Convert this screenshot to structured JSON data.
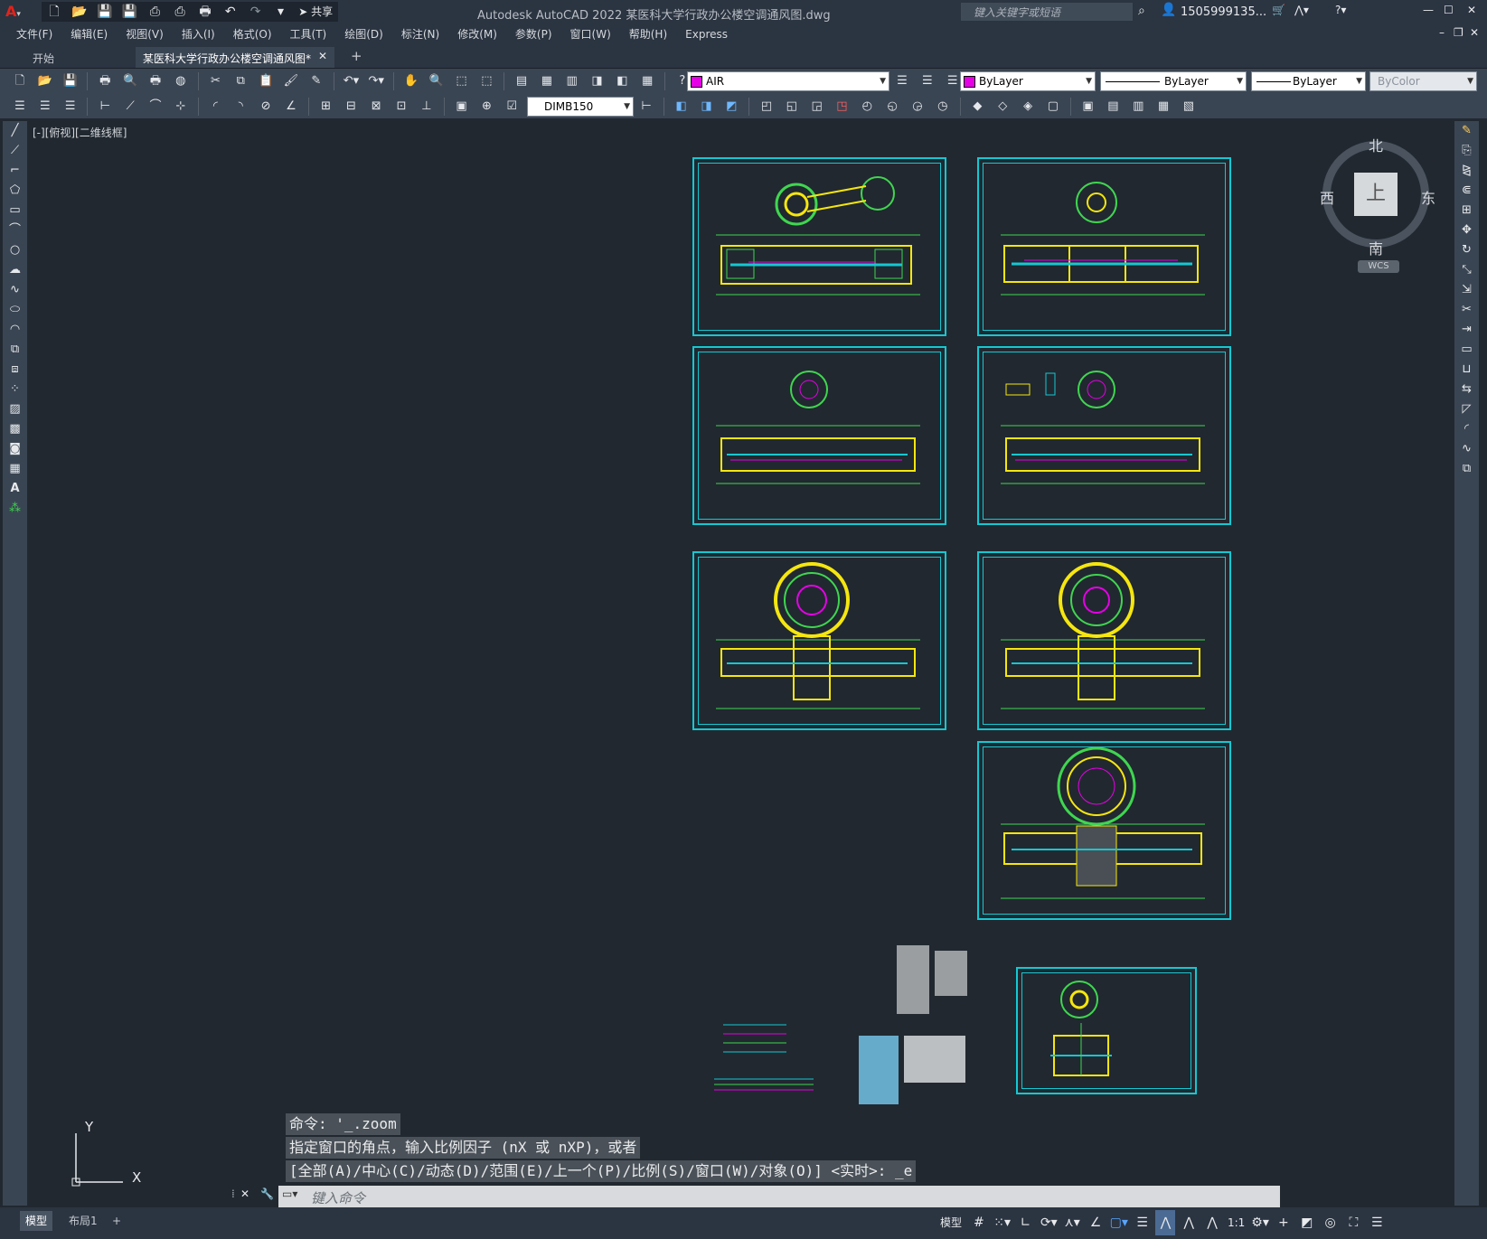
{
  "window": {
    "title": "Autodesk AutoCAD 2022    某医科大学行政办公楼空调通风图.dwg",
    "share_label": "共享",
    "search_placeholder": "键入关键字或短语",
    "user": "1505999135...",
    "minimize": "—",
    "maximize": "☐",
    "close": "✕"
  },
  "menu": [
    "文件(F)",
    "编辑(E)",
    "视图(V)",
    "插入(I)",
    "格式(O)",
    "工具(T)",
    "绘图(D)",
    "标注(N)",
    "修改(M)",
    "参数(P)",
    "窗口(W)",
    "帮助(H)",
    "Express"
  ],
  "tabs": {
    "start": "开始",
    "drawing": "某医科大学行政办公楼空调通风图*",
    "add": "+"
  },
  "toolbar": {
    "layer": "AIR",
    "color": "ByLayer",
    "linetype": "ByLayer",
    "lineweight": "ByLayer",
    "plotstyle": "ByColor",
    "dimstyle": "DIMB150"
  },
  "viewport_label": "[-][俯视][二维线框]",
  "viewcube": {
    "north": "北",
    "south": "南",
    "east": "东",
    "west": "西",
    "top": "上",
    "wcs": "WCS"
  },
  "ucs": {
    "x": "X",
    "y": "Y"
  },
  "command": {
    "history": [
      "命令: '_.zoom",
      "指定窗口的角点，输入比例因子 (nX 或 nXP)，或者",
      "[全部(A)/中心(C)/动态(D)/范围(E)/上一个(P)/比例(S)/窗口(W)/对象(O)] <实时>: _e"
    ],
    "placeholder": "键入命令"
  },
  "layout_tabs": [
    "模型",
    "布局1",
    "+"
  ],
  "status": {
    "model": "模型",
    "scale": "1:1"
  },
  "colors": {
    "sheet_border": "#14c8d2",
    "layer_swatch": "#e600e6",
    "background": "#212830"
  }
}
